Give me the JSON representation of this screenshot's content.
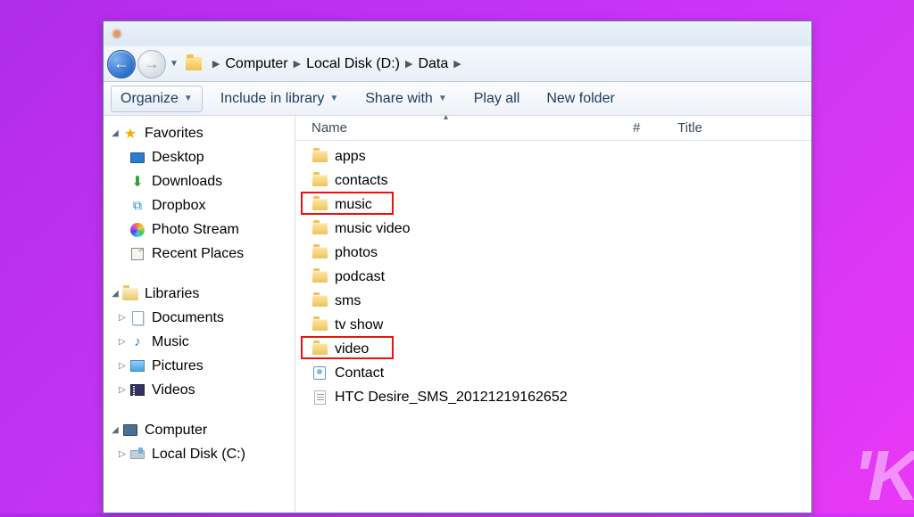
{
  "breadcrumb": {
    "items": [
      "Computer",
      "Local Disk (D:)",
      "Data"
    ]
  },
  "toolbar": {
    "organize": "Organize",
    "include": "Include in library",
    "share": "Share with",
    "play": "Play all",
    "newfolder": "New folder"
  },
  "columns": {
    "name": "Name",
    "num": "#",
    "title": "Title"
  },
  "sidebar": {
    "favorites": {
      "header": "Favorites",
      "items": [
        "Desktop",
        "Downloads",
        "Dropbox",
        "Photo Stream",
        "Recent Places"
      ]
    },
    "libraries": {
      "header": "Libraries",
      "items": [
        "Documents",
        "Music",
        "Pictures",
        "Videos"
      ]
    },
    "computer": {
      "header": "Computer",
      "items": [
        "Local Disk (C:)"
      ]
    }
  },
  "files": {
    "items": [
      {
        "name": "apps",
        "type": "folder"
      },
      {
        "name": "contacts",
        "type": "folder"
      },
      {
        "name": "music",
        "type": "folder",
        "highlighted": true
      },
      {
        "name": "music video",
        "type": "folder"
      },
      {
        "name": "photos",
        "type": "folder"
      },
      {
        "name": "podcast",
        "type": "folder"
      },
      {
        "name": "sms",
        "type": "folder"
      },
      {
        "name": "tv show",
        "type": "folder"
      },
      {
        "name": "video",
        "type": "folder",
        "highlighted": true
      },
      {
        "name": "Contact",
        "type": "contact"
      },
      {
        "name": "HTC Desire_SMS_20121219162652",
        "type": "text"
      }
    ]
  },
  "watermark": "'K"
}
